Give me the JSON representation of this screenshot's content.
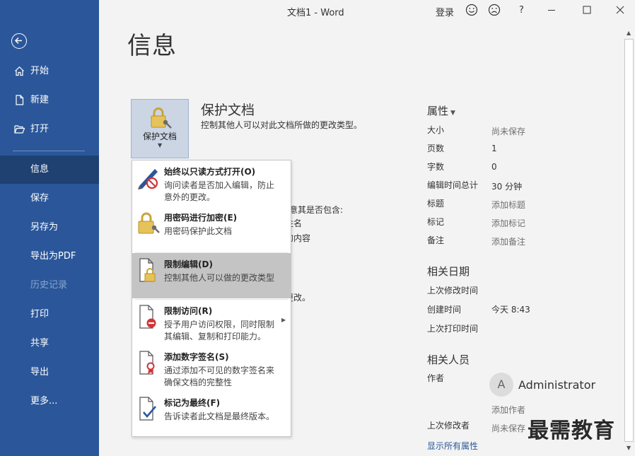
{
  "window": {
    "title": "文档1  -  Word",
    "login": "登录",
    "help": "?"
  },
  "sidebar": {
    "items": [
      {
        "label": "开始"
      },
      {
        "label": "新建"
      },
      {
        "label": "打开"
      },
      {
        "label": "信息"
      },
      {
        "label": "保存"
      },
      {
        "label": "另存为"
      },
      {
        "label": "导出为PDF"
      },
      {
        "label": "历史记录"
      },
      {
        "label": "打印"
      },
      {
        "label": "共享"
      },
      {
        "label": "导出"
      },
      {
        "label": "更多..."
      }
    ]
  },
  "main": {
    "page_title": "信息",
    "protect_tile_label": "保护文档",
    "protect_heading": "保护文档",
    "protect_desc": "控制其他人可以对此文档所做的更改类型。",
    "partial_lines": [
      "注意其是否包含:",
      "姓名",
      "的内容",
      "更改。"
    ]
  },
  "menu": {
    "items": [
      {
        "title": "始终以只读方式打开(O)",
        "desc": "询问读者是否加入编辑，防止意外的更改。"
      },
      {
        "title": "用密码进行加密(E)",
        "desc": "用密码保护此文档"
      },
      {
        "title": "限制编辑(D)",
        "desc": "控制其他人可以做的更改类型"
      },
      {
        "title": "限制访问(R)",
        "desc": "授予用户访问权限，同时限制其编辑、复制和打印能力。"
      },
      {
        "title": "添加数字签名(S)",
        "desc": "通过添加不可见的数字签名来确保文档的完整性"
      },
      {
        "title": "标记为最终(F)",
        "desc": "告诉读者此文档是最终版本。"
      }
    ]
  },
  "properties": {
    "heading": "属性",
    "rows": [
      {
        "label": "大小",
        "value": "尚未保存"
      },
      {
        "label": "页数",
        "value": "1"
      },
      {
        "label": "字数",
        "value": "0"
      },
      {
        "label": "编辑时间总计",
        "value": "30 分钟"
      },
      {
        "label": "标题",
        "value": "添加标题"
      },
      {
        "label": "标记",
        "value": "添加标记"
      },
      {
        "label": "备注",
        "value": "添加备注"
      }
    ],
    "dates_heading": "相关日期",
    "dates": [
      {
        "label": "上次修改时间",
        "value": ""
      },
      {
        "label": "创建时间",
        "value": "今天 8:43"
      },
      {
        "label": "上次打印时间",
        "value": ""
      }
    ],
    "people_heading": "相关人员",
    "author_label": "作者",
    "author_initial": "A",
    "author_name": "Administrator",
    "add_author": "添加作者",
    "last_modified_by_label": "上次修改者",
    "last_modified_by_value": "尚未保存",
    "show_all": "显示所有属性"
  },
  "watermark": "最需教育",
  "colors": {
    "sidebar": "#2b579a",
    "sidebar_active": "#1e4172",
    "menu_highlight": "#c4c4c4",
    "link": "#2b579a"
  }
}
